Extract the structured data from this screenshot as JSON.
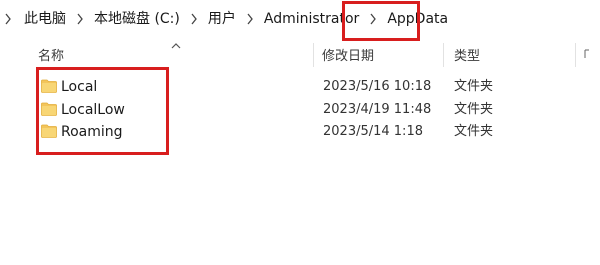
{
  "breadcrumb": {
    "items": [
      {
        "label": "此电脑"
      },
      {
        "label": "本地磁盘 (C:)"
      },
      {
        "label": "用户"
      },
      {
        "label": "Administrator"
      },
      {
        "label": "AppData"
      }
    ]
  },
  "columns": {
    "name": "名称",
    "date_modified": "修改日期",
    "type": "类型"
  },
  "files": [
    {
      "name": "Local",
      "date": "2023/5/16 10:18",
      "type": "文件夹",
      "icon": "folder-icon"
    },
    {
      "name": "LocalLow",
      "date": "2023/4/19 11:48",
      "type": "文件夹",
      "icon": "folder-icon"
    },
    {
      "name": "Roaming",
      "date": "2023/5/14 1:18",
      "type": "文件夹",
      "icon": "folder-icon"
    }
  ],
  "colors": {
    "highlight": "#d81e1e",
    "folder": "#f3c55b",
    "folder_dark": "#e2ad3a"
  }
}
